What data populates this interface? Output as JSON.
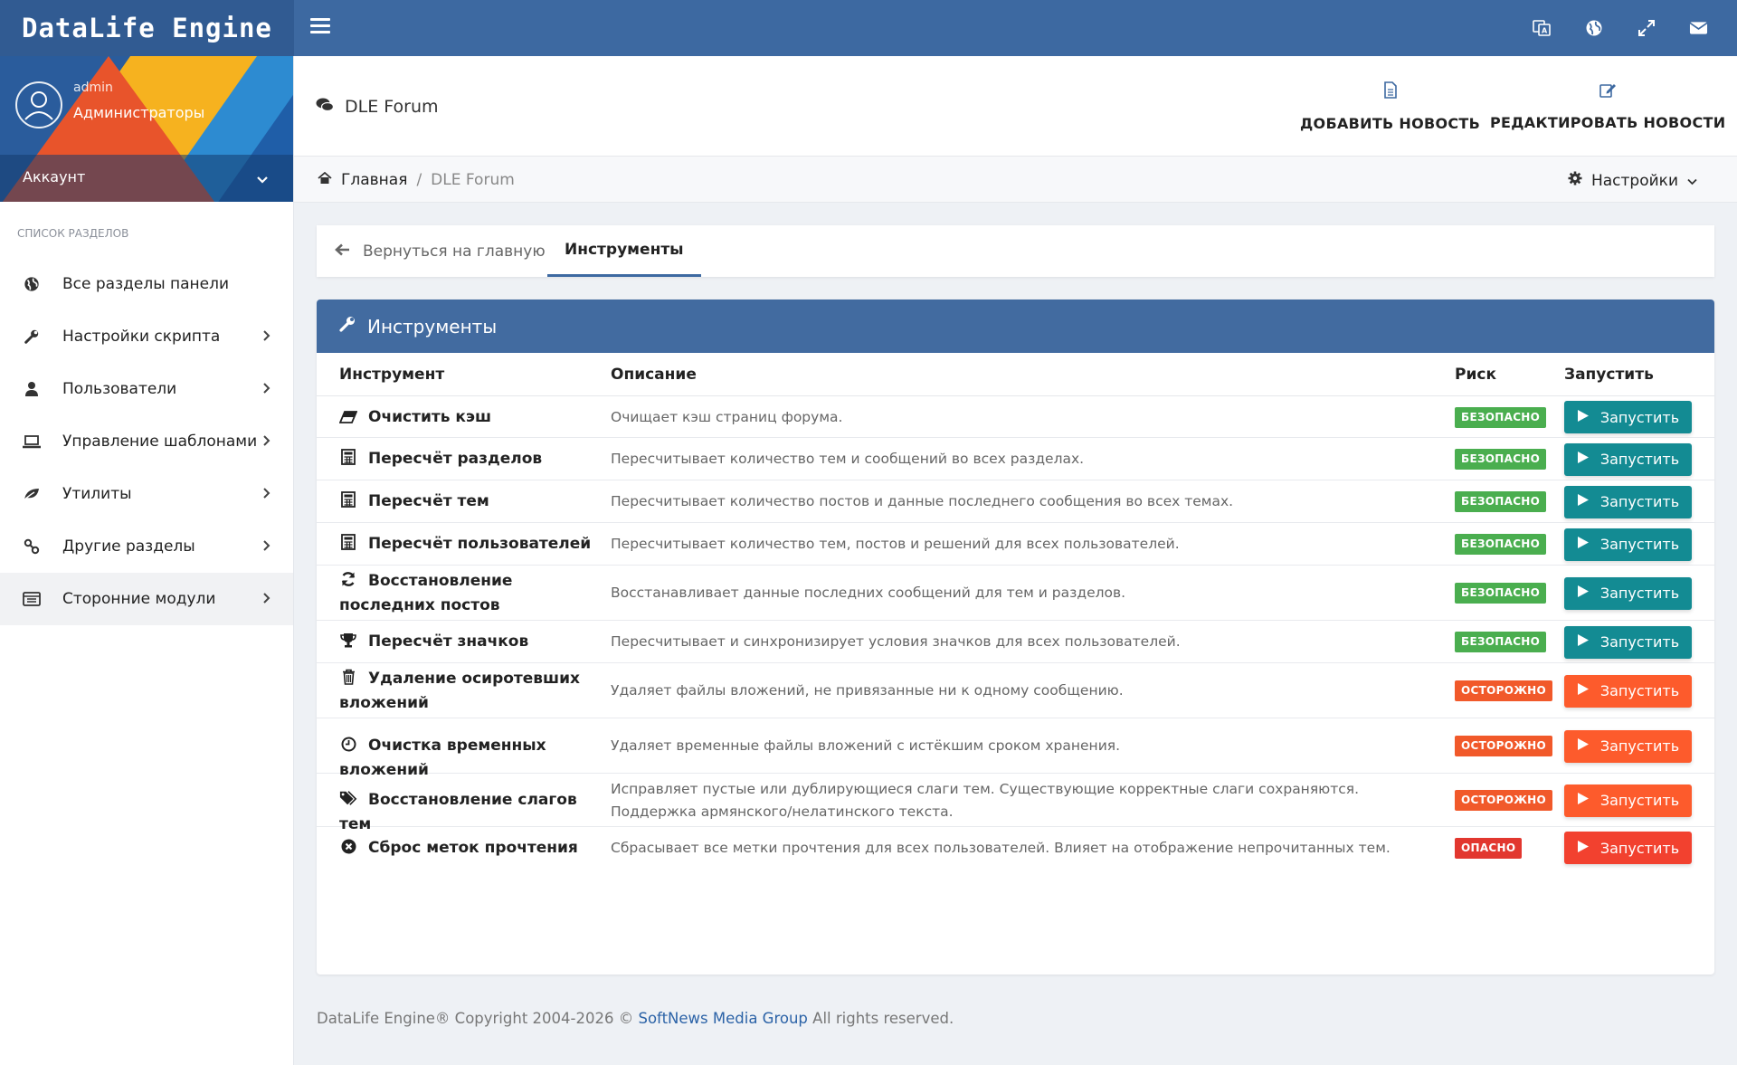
{
  "app": {
    "logo": "DataLife Engine"
  },
  "topbar": {
    "icons": [
      "translate-icon",
      "globe-icon",
      "fullscreen-icon",
      "envelope-icon"
    ]
  },
  "user": {
    "name": "admin",
    "role": "Администраторы",
    "account_label": "Аккаунт"
  },
  "sidebar": {
    "heading": "СПИСОК РАЗДЕЛОВ",
    "items": [
      {
        "label": "Все разделы панели",
        "icon": "globe-icon",
        "has_submenu": false
      },
      {
        "label": "Настройки скрипта",
        "icon": "wrench-icon",
        "has_submenu": true
      },
      {
        "label": "Пользователи",
        "icon": "user-icon",
        "has_submenu": true
      },
      {
        "label": "Управление шаблонами",
        "icon": "laptop-icon",
        "has_submenu": true
      },
      {
        "label": "Утилиты",
        "icon": "leaf-icon",
        "has_submenu": true
      },
      {
        "label": "Другие разделы",
        "icon": "link-icon",
        "has_submenu": true
      },
      {
        "label": "Сторонние модули",
        "icon": "list-icon",
        "has_submenu": true,
        "active": true
      }
    ]
  },
  "header": {
    "title": "DLE Forum",
    "add_news": "ДОБАВИТЬ НОВОСТЬ",
    "edit_news": "РЕДАКТИРОВАТЬ НОВОСТИ"
  },
  "breadcrumb": {
    "home": "Главная",
    "separator": "/",
    "current": "DLE Forum",
    "settings": "Настройки"
  },
  "tabs": {
    "back": "Вернуться на главную",
    "active": "Инструменты"
  },
  "panel": {
    "title": "Инструменты",
    "columns": {
      "tool": "Инструмент",
      "description": "Описание",
      "risk": "Риск",
      "run": "Запустить"
    },
    "rows": [
      {
        "icon": "eraser-icon",
        "tool": "Очистить кэш",
        "description": "Очищает кэш страниц форума.",
        "risk": "БЕЗОПАСНО",
        "level": "safe",
        "button": "Запустить"
      },
      {
        "icon": "calculator-icon",
        "tool": "Пересчёт разделов",
        "description": "Пересчитывает количество тем и сообщений во всех разделах.",
        "risk": "БЕЗОПАСНО",
        "level": "safe",
        "button": "Запустить"
      },
      {
        "icon": "calculator-icon",
        "tool": "Пересчёт тем",
        "description": "Пересчитывает количество постов и данные последнего сообщения во всех темах.",
        "risk": "БЕЗОПАСНО",
        "level": "safe",
        "button": "Запустить"
      },
      {
        "icon": "calculator-icon",
        "tool": "Пересчёт пользователей",
        "description": "Пересчитывает количество тем, постов и решений для всех пользователей.",
        "risk": "БЕЗОПАСНО",
        "level": "safe",
        "button": "Запустить"
      },
      {
        "icon": "refresh-icon",
        "tool": "Восстановление последних постов",
        "description": "Восстанавливает данные последних сообщений для тем и разделов.",
        "risk": "БЕЗОПАСНО",
        "level": "safe",
        "button": "Запустить"
      },
      {
        "icon": "trophy-icon",
        "tool": "Пересчёт значков",
        "description": "Пересчитывает и синхронизирует условия значков для всех пользователей.",
        "risk": "БЕЗОПАСНО",
        "level": "safe",
        "button": "Запустить"
      },
      {
        "icon": "trash-icon",
        "tool": "Удаление осиротевших вложений",
        "description": "Удаляет файлы вложений, не привязанные ни к одному сообщению.",
        "risk": "ОСТОРОЖНО",
        "level": "careful",
        "button": "Запустить"
      },
      {
        "icon": "clock-icon",
        "tool": "Очистка временных вложений",
        "description": "Удаляет временные файлы вложений с истёкшим сроком хранения.",
        "risk": "ОСТОРОЖНО",
        "level": "careful",
        "button": "Запустить"
      },
      {
        "icon": "tags-icon",
        "tool": "Восстановление слагов тем",
        "description": "Исправляет пустые или дублирующиеся слаги тем. Существующие корректные слаги сохраняются. Поддержка армянского/нелатинского текста.",
        "risk": "ОСТОРОЖНО",
        "level": "careful",
        "button": "Запустить"
      },
      {
        "icon": "times-circle-icon",
        "tool": "Сброс меток прочтения",
        "description": "Сбрасывает все метки прочтения для всех пользователей. Влияет на отображение непрочитанных тем.",
        "risk": "ОПАСНО",
        "level": "danger",
        "button": "Запустить"
      }
    ]
  },
  "footer": {
    "prefix": "DataLife Engine® Copyright 2004-2026 ©",
    "link": "SoftNews Media Group",
    "suffix": "All rights reserved."
  },
  "colors": {
    "topbar": "#3d69a1",
    "panel_head": "#426ba0",
    "safe": "#4aae4f",
    "careful": "#f1592a",
    "danger": "#e2372f",
    "btn_teal": "#138b93",
    "btn_orange": "#fd5b2c",
    "btn_red": "#f2412f"
  }
}
